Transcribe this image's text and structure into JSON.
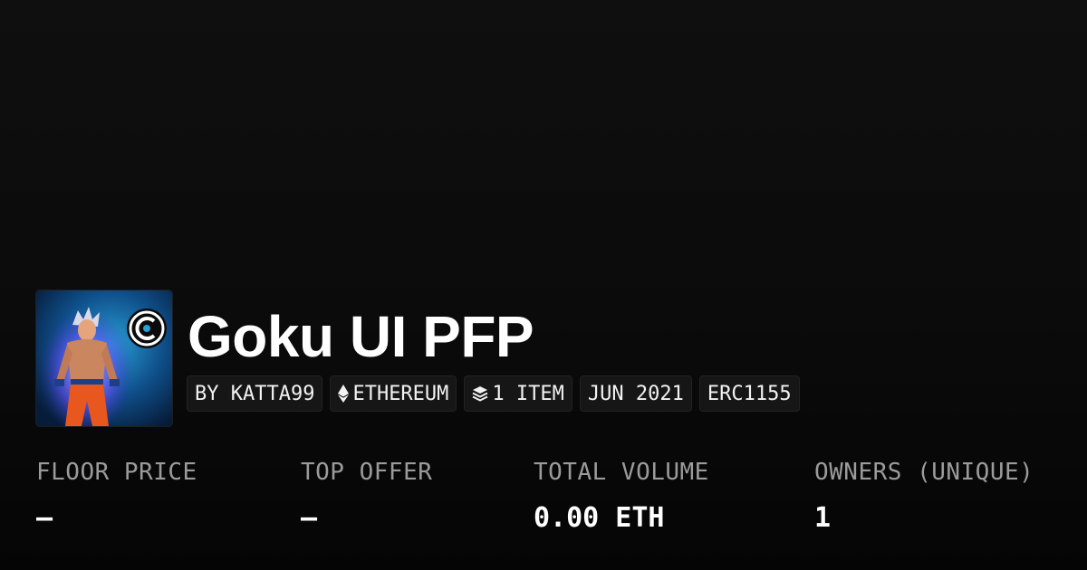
{
  "collection": {
    "title": "Goku UI PFP",
    "avatar_alt": "Goku UI PFP",
    "tags": [
      {
        "label": "BY KATTA99",
        "icon": ""
      },
      {
        "label": "ETHEREUM",
        "icon": "ethereum-icon"
      },
      {
        "label": "1 ITEM",
        "icon": "layers-icon"
      },
      {
        "label": "JUN 2021",
        "icon": ""
      },
      {
        "label": "ERC1155",
        "icon": ""
      }
    ]
  },
  "stats": [
    {
      "label": "FLOOR PRICE",
      "value": "–"
    },
    {
      "label": "TOP OFFER",
      "value": "–"
    },
    {
      "label": "TOTAL VOLUME",
      "value": "0.00 ETH"
    },
    {
      "label": "OWNERS (UNIQUE)",
      "value": "1"
    }
  ],
  "colors": {
    "background": "#0b0b0b",
    "tag_background": "#161616",
    "label": "#9b9b9b",
    "text": "#ffffff"
  }
}
